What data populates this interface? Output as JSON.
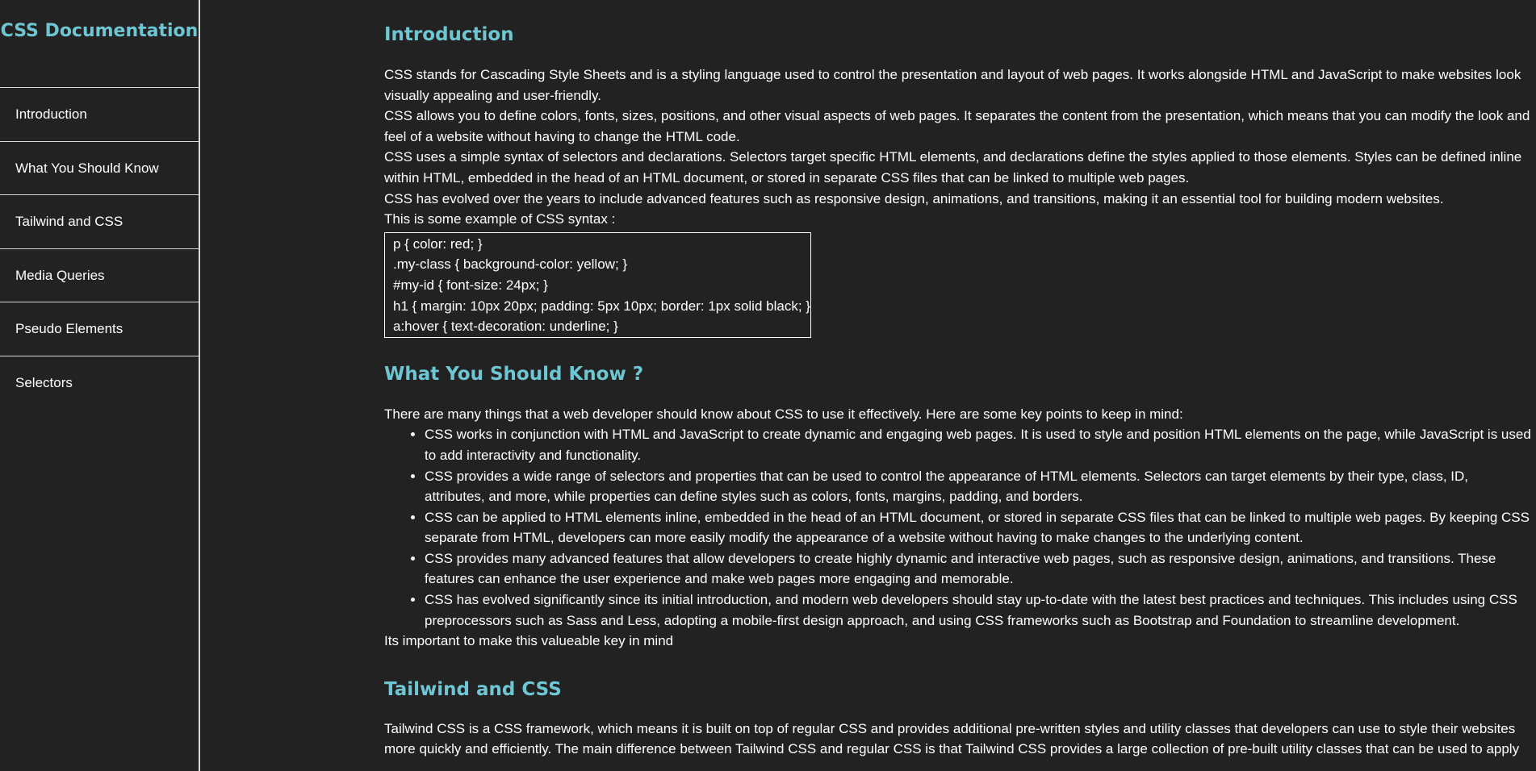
{
  "navbar": {
    "title": "CSS Documentation",
    "links": [
      {
        "label": "Introduction"
      },
      {
        "label": "What You Should Know"
      },
      {
        "label": "Tailwind and CSS"
      },
      {
        "label": "Media Queries"
      },
      {
        "label": "Pseudo Elements"
      },
      {
        "label": "Selectors"
      }
    ]
  },
  "sections": {
    "introduction": {
      "title": "Introduction",
      "paragraphs": [
        "CSS stands for Cascading Style Sheets and is a styling language used to control the presentation and layout of web pages. It works alongside HTML and JavaScript to make websites look visually appealing and user-friendly.",
        "CSS allows you to define colors, fonts, sizes, positions, and other visual aspects of web pages. It separates the content from the presentation, which means that you can modify the look and feel of a website without having to change the HTML code.",
        "CSS uses a simple syntax of selectors and declarations. Selectors target specific HTML elements, and declarations define the styles applied to those elements. Styles can be defined inline within HTML, embedded in the head of an HTML document, or stored in separate CSS files that can be linked to multiple web pages.",
        "CSS has evolved over the years to include advanced features such as responsive design, animations, and transitions, making it an essential tool for building modern websites.",
        "This is some example of CSS syntax :"
      ],
      "code": [
        "p { color: red; }",
        ".my-class { background-color: yellow; }",
        "#my-id { font-size: 24px; }",
        "h1 { margin: 10px 20px; padding: 5px 10px; border: 1px solid black; }",
        "a:hover { text-decoration: underline; }"
      ]
    },
    "what_you_should_know": {
      "title": "What You Should Know ?",
      "intro": "There are many things that a web developer should know about CSS to use it effectively. Here are some key points to keep in mind:",
      "points": [
        "CSS works in conjunction with HTML and JavaScript to create dynamic and engaging web pages. It is used to style and position HTML elements on the page, while JavaScript is used to add interactivity and functionality.",
        "CSS provides a wide range of selectors and properties that can be used to control the appearance of HTML elements. Selectors can target elements by their type, class, ID, attributes, and more, while properties can define styles such as colors, fonts, margins, padding, and borders.",
        "CSS can be applied to HTML elements inline, embedded in the head of an HTML document, or stored in separate CSS files that can be linked to multiple web pages. By keeping CSS separate from HTML, developers can more easily modify the appearance of a website without having to make changes to the underlying content.",
        "CSS provides many advanced features that allow developers to create highly dynamic and interactive web pages, such as responsive design, animations, and transitions. These features can enhance the user experience and make web pages more engaging and memorable.",
        "CSS has evolved significantly since its initial introduction, and modern web developers should stay up-to-date with the latest best practices and techniques. This includes using CSS preprocessors such as Sass and Less, adopting a mobile-first design approach, and using CSS frameworks such as Bootstrap and Foundation to streamline development."
      ],
      "outro": "Its important to make this valueable key in mind"
    },
    "tailwind": {
      "title": "Tailwind and CSS",
      "paragraph": "Tailwind CSS is a CSS framework, which means it is built on top of regular CSS and provides additional pre-written styles and utility classes that developers can use to style their websites more quickly and efficiently. The main difference between Tailwind CSS and regular CSS is that Tailwind CSS provides a large collection of pre-built utility classes that can be used to apply"
    }
  },
  "colors": {
    "background": "#222222",
    "accent": "#6ec6d2",
    "text": "#ffffff",
    "divider": "#d8d8d8"
  }
}
